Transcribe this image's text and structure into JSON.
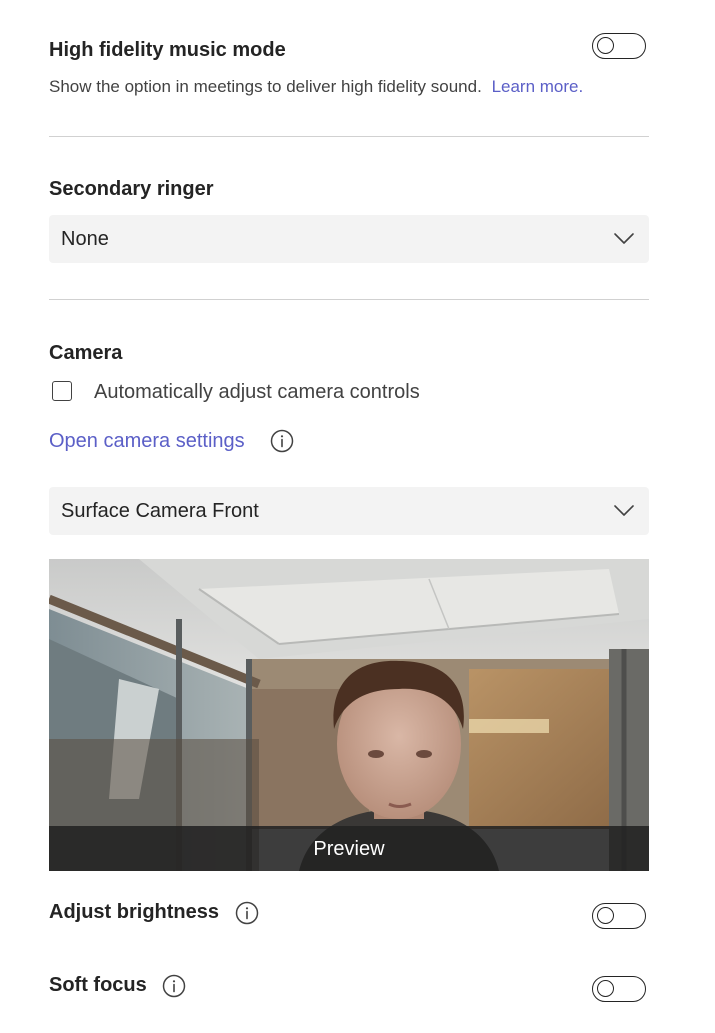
{
  "music_mode": {
    "title": "High fidelity music mode",
    "description": "Show the option in meetings to deliver high fidelity sound.",
    "learn_more": "Learn more.",
    "enabled": false
  },
  "secondary_ringer": {
    "title": "Secondary ringer",
    "selected": "None"
  },
  "camera": {
    "title": "Camera",
    "auto_adjust_label": "Automatically adjust camera controls",
    "auto_adjust_checked": false,
    "open_settings_link": "Open camera settings",
    "selected_device": "Surface Camera Front",
    "preview_label": "Preview"
  },
  "adjust_brightness": {
    "title": "Adjust brightness",
    "enabled": false
  },
  "soft_focus": {
    "title": "Soft focus",
    "enabled": false
  },
  "colors": {
    "accent": "#5b5fc7",
    "text": "#242424",
    "divider": "#d1d1d1",
    "dropdown_bg": "#f3f3f3"
  },
  "icons": {
    "dropdown": "chevron-down-icon",
    "info": "info-icon"
  }
}
